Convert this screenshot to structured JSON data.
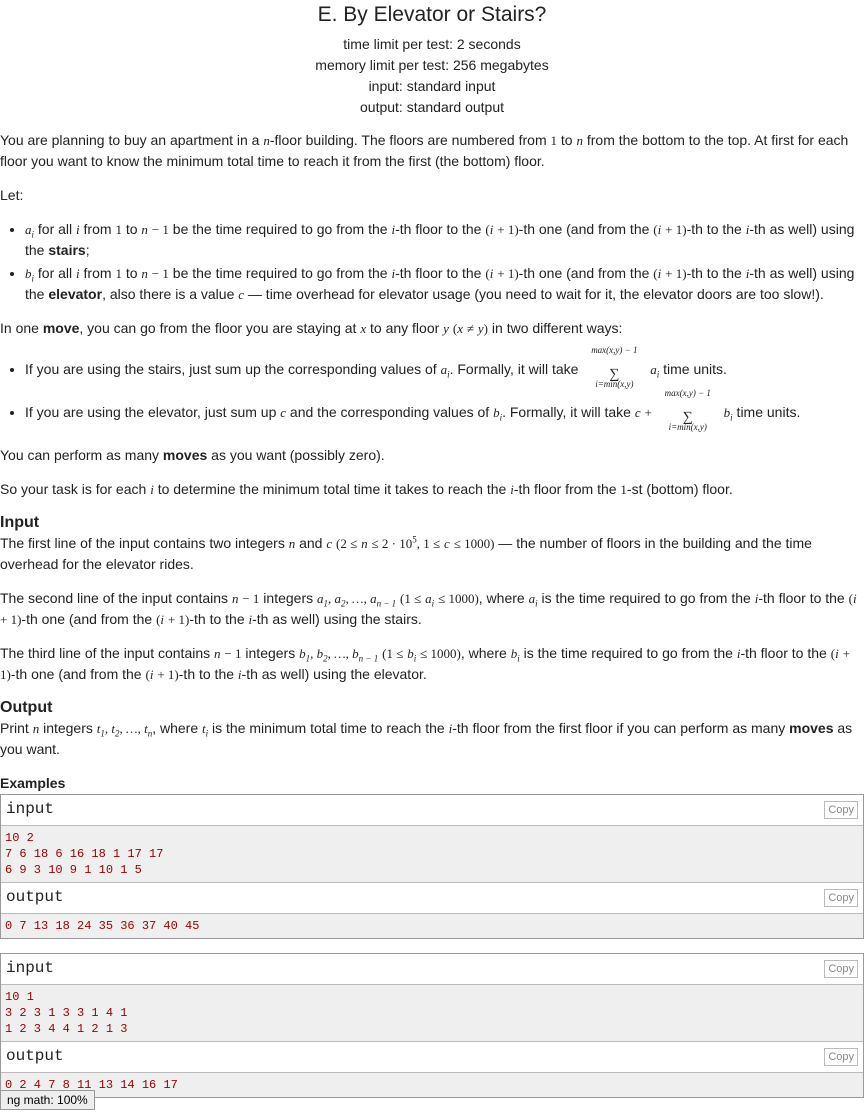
{
  "header": {
    "title": "E. By Elevator or Stairs?",
    "time_limit": "time limit per test: 2 seconds",
    "memory_limit": "memory limit per test: 256 megabytes",
    "input": "input: standard input",
    "output": "output: standard output"
  },
  "sections": {
    "input_title": "Input",
    "output_title": "Output",
    "examples_title": "Examples"
  },
  "examples": [
    {
      "input_label": "input",
      "input_text": "10 2\n7 6 18 6 16 18 1 17 17\n6 9 3 10 9 1 10 1 5",
      "output_label": "output",
      "output_text": "0 7 13 18 24 35 36 37 40 45",
      "copy": "Copy"
    },
    {
      "input_label": "input",
      "input_text": "10 1\n3 2 3 1 3 3 1 4 1\n1 2 3 4 4 1 2 1 3",
      "output_label": "output",
      "output_text": "0 2 4 7 8 11 13 14 16 17",
      "copy": "Copy"
    }
  ],
  "status_bar": "ng math: 100%"
}
